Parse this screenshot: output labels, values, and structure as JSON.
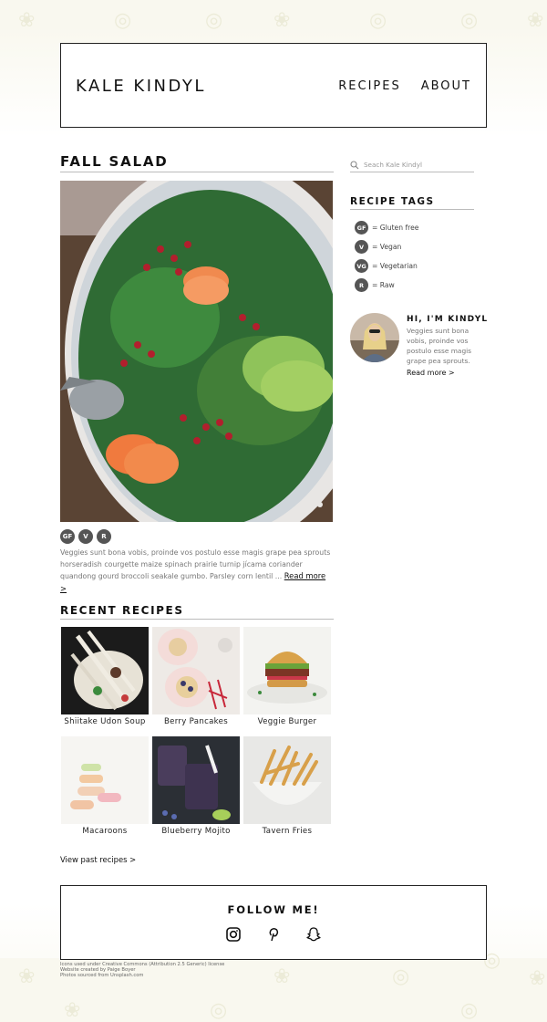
{
  "site": {
    "title": "KALE KINDYL",
    "nav": [
      "RECIPES",
      "ABOUT"
    ]
  },
  "post": {
    "title": "FALL SALAD",
    "image_icon": "salad-photo",
    "tags": [
      "GF",
      "V",
      "R"
    ],
    "excerpt": "Veggies sunt bona vobis, proinde vos postulo esse magis grape pea sprouts horseradish courgette maize spinach prairie turnip jícama coriander quandong gourd broccoli seakale gumbo. Parsley corn lentil ...",
    "read_more": "Read more >"
  },
  "recent": {
    "title": "RECENT RECIPES",
    "items": [
      {
        "name": "Shiitake Udon Soup"
      },
      {
        "name": "Berry Pancakes"
      },
      {
        "name": "Veggie Burger"
      },
      {
        "name": "Macaroons"
      },
      {
        "name": "Blueberry Mojito"
      },
      {
        "name": "Tavern Fries"
      }
    ],
    "past_link": "View past recipes >"
  },
  "sidebar": {
    "search_placeholder": "Seach Kale Kindyl",
    "tags_title": "RECIPE TAGS",
    "tags": [
      {
        "code": "GF",
        "label": "= Gluten free"
      },
      {
        "code": "V",
        "label": "= Vegan"
      },
      {
        "code": "VG",
        "label": "= Vegetarian"
      },
      {
        "code": "R",
        "label": "= Raw"
      }
    ],
    "about_title": "HI, I'M KINDYL",
    "about_text": "Veggies sunt bona vobis, proinde vos postulo esse magis grape pea sprouts.",
    "about_more": "Read more >"
  },
  "footer": {
    "follow_title": "FOLLOW ME!",
    "social_icons": [
      "instagram-icon",
      "pinterest-icon",
      "snapchat-icon"
    ],
    "credits": [
      "Icons used under Creative Commons (Attribution 2.5 Generic) license",
      "Website created by Paige Boyer",
      "Photos sourced from Unsplash.com"
    ]
  },
  "colors": {
    "background": "#f9f8ef",
    "text": "#222222",
    "tag_badge": "#555555"
  }
}
